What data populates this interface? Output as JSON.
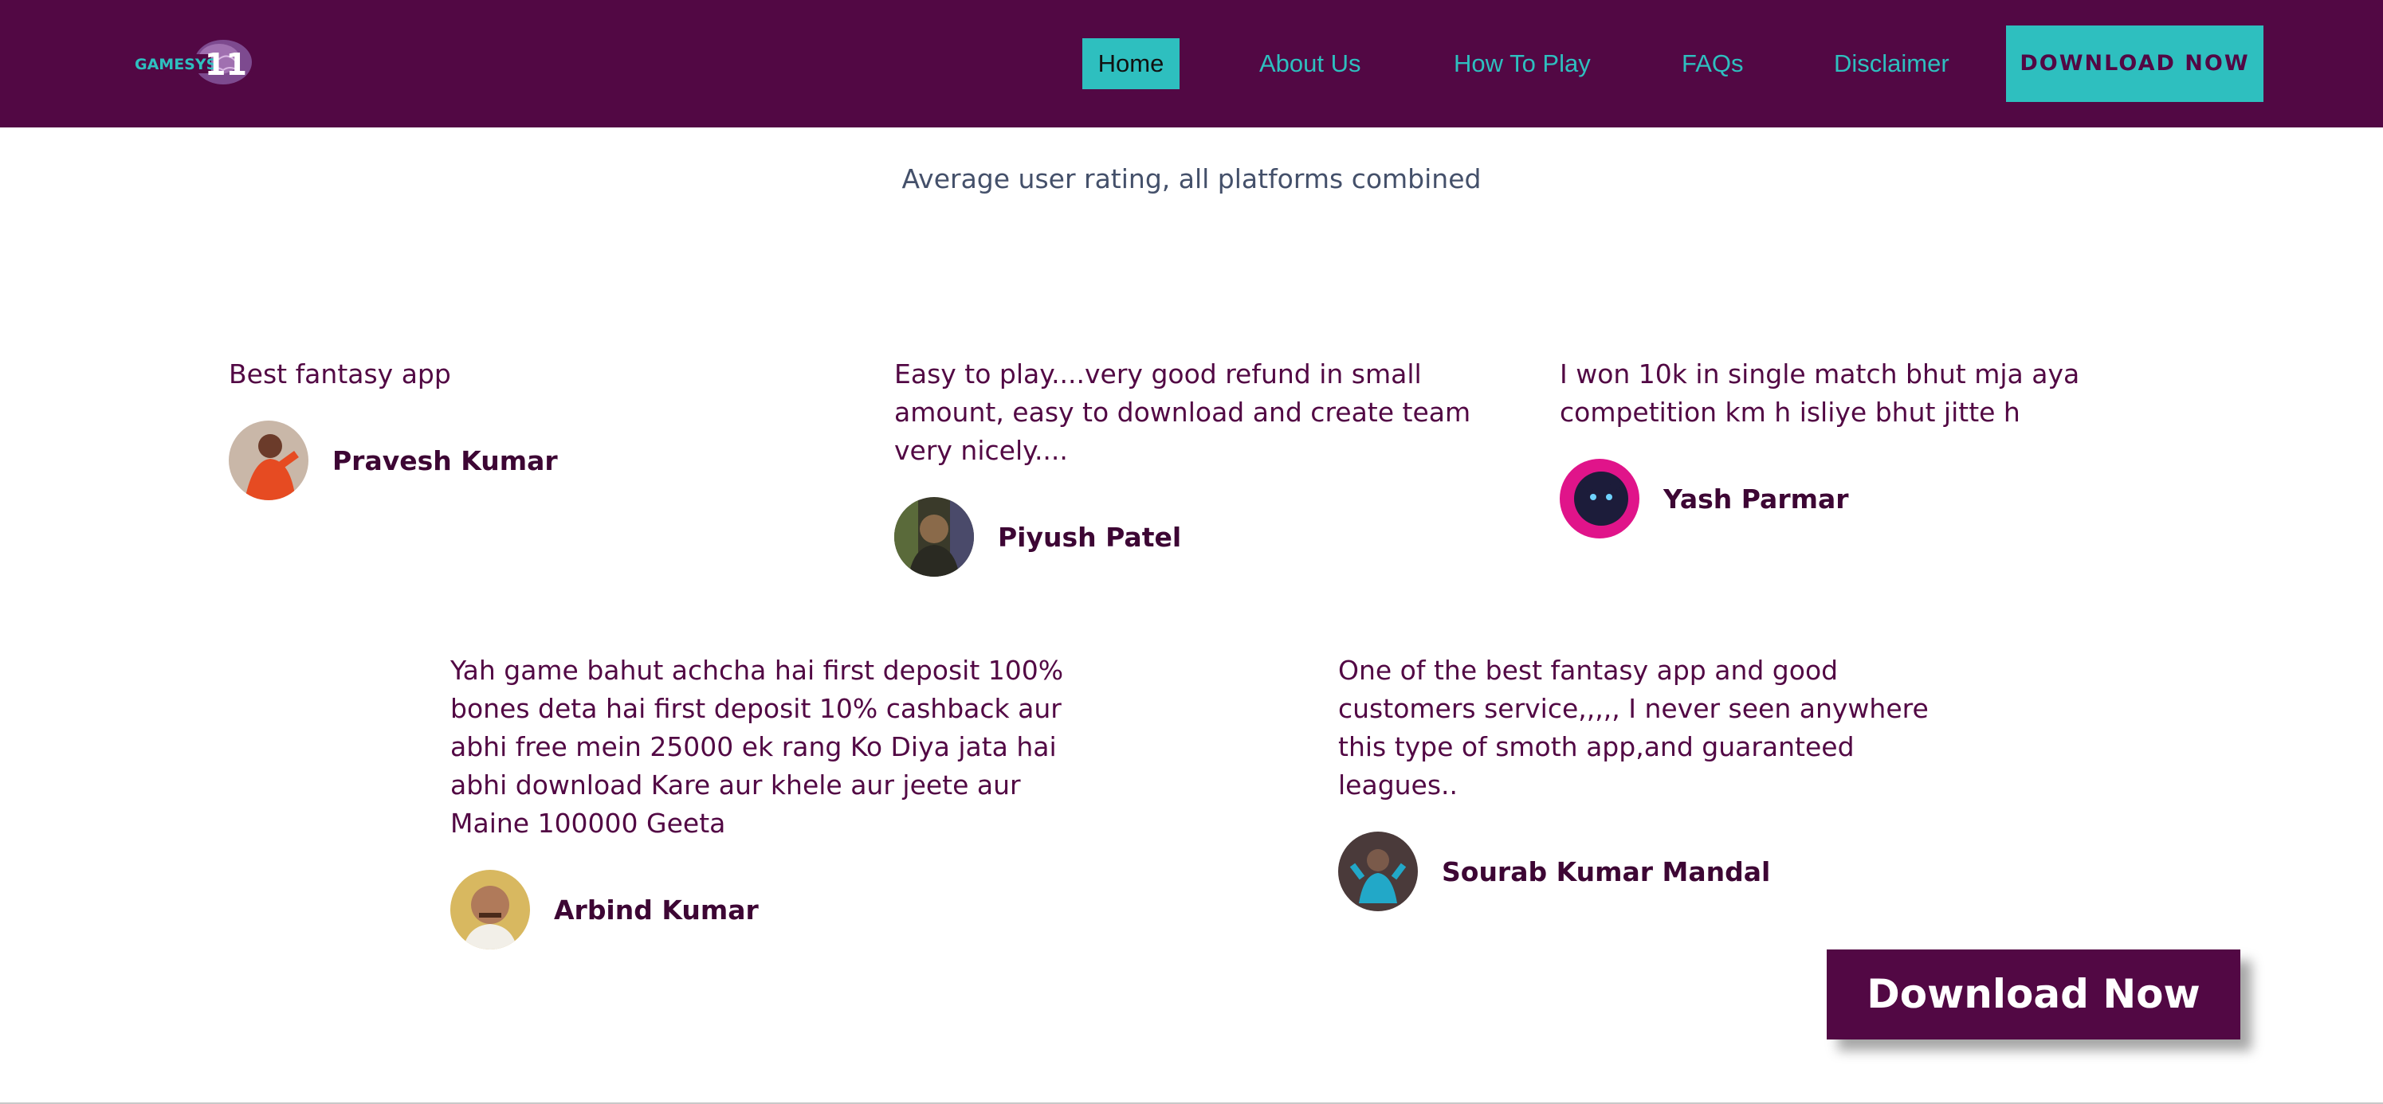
{
  "header": {
    "logo_text": "GAMESYS 11",
    "nav": {
      "home": "Home",
      "about": "About Us",
      "how_to_play": "How To Play",
      "faqs": "FAQs",
      "disclaimer": "Disclaimer"
    },
    "download_button": "DOWNLOAD NOW"
  },
  "rating": {
    "caption": "Average user rating, all platforms combined"
  },
  "reviews": [
    {
      "quote": "Best fantasy app",
      "name": "Pravesh Kumar",
      "avatar": "avatar-photo"
    },
    {
      "quote": "Easy to play....very good refund in small amount, easy to download and create team very nicely....",
      "name": "Piyush Patel",
      "avatar": "avatar-photo"
    },
    {
      "quote": "I won 10k in single match bhut mja aya competition km h isliye bhut jitte h",
      "name": "Yash Parmar",
      "avatar": "avatar-photo"
    },
    {
      "quote": "Yah game bahut achcha hai first deposit 100% bones deta hai first deposit 10% cashback aur abhi free mein 25000 ek rang Ko Diya jata hai abhi download Kare aur khele aur jeete aur Maine 100000 Geeta",
      "name": "Arbind Kumar",
      "avatar": "avatar-photo"
    },
    {
      "quote": "One of the best fantasy app and good customers service,,,,, I never seen anywhere this type of smoth app,and guaranteed leagues..",
      "name": "Sourab Kumar Mandal",
      "avatar": "avatar-photo"
    }
  ],
  "floating_button": "Download Now",
  "colors": {
    "brand_purple": "#520844",
    "accent_teal": "#2ebfbf"
  }
}
